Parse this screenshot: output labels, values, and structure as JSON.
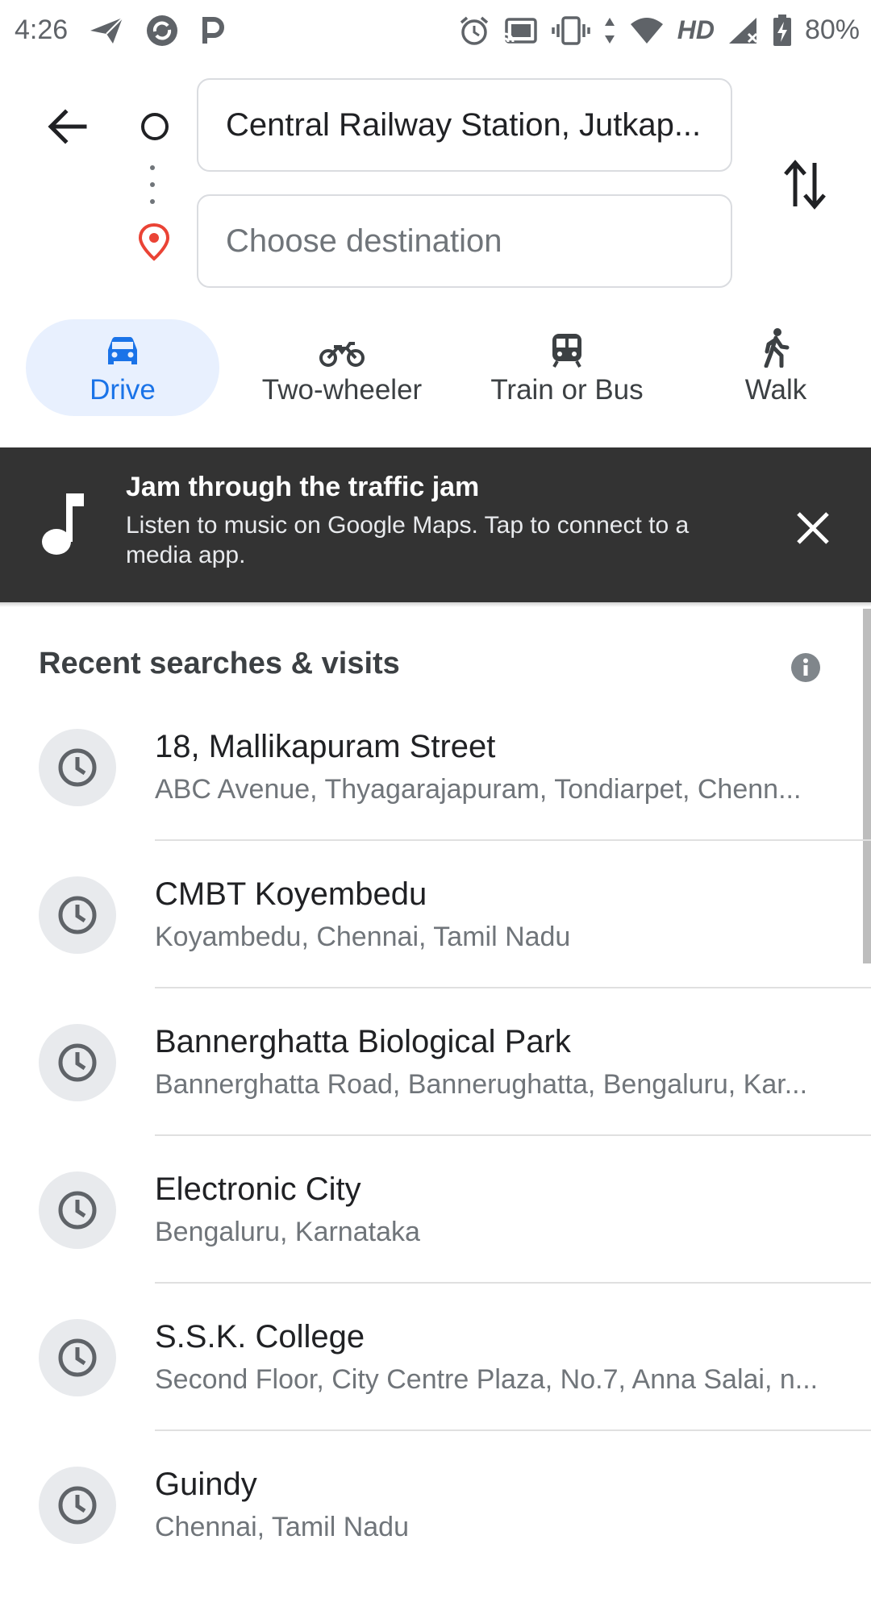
{
  "status_bar": {
    "time": "4:26",
    "network_label": "HD",
    "battery": "80%",
    "left_icons": [
      "send-icon",
      "sync-app-icon",
      "parking-icon"
    ],
    "right_icons": [
      "alarm-icon",
      "cast-icon",
      "vibrate-icon",
      "data-arrows-icon",
      "wifi-icon",
      "signal-icon",
      "battery-charging-icon"
    ]
  },
  "directions": {
    "origin": "Central Railway Station, Jutkap...",
    "destination_placeholder": "Choose destination"
  },
  "modes": [
    {
      "label": "Drive",
      "icon": "car-icon",
      "active": true
    },
    {
      "label": "Two-wheeler",
      "icon": "motorbike-icon",
      "active": false
    },
    {
      "label": "Train or Bus",
      "icon": "train-icon",
      "active": false
    },
    {
      "label": "Walk",
      "icon": "walk-icon",
      "active": false
    }
  ],
  "banner": {
    "title": "Jam through the traffic jam",
    "body": "Listen to music on Google Maps. Tap to connect to a media app."
  },
  "recent": {
    "title": "Recent searches & visits",
    "items": [
      {
        "title": "18, Mallikapuram Street",
        "subtitle": "ABC Avenue, Thyagarajapuram, Tondiarpet, Chenn..."
      },
      {
        "title": "CMBT Koyembedu",
        "subtitle": "Koyambedu, Chennai, Tamil Nadu"
      },
      {
        "title": "Bannerghatta Biological Park",
        "subtitle": "Bannerghatta Road, Bannerughatta, Bengaluru, Kar..."
      },
      {
        "title": "Electronic City",
        "subtitle": "Bengaluru, Karnataka"
      },
      {
        "title": "S.S.K. College",
        "subtitle": "Second Floor, City Centre Plaza, No.7, Anna Salai, n..."
      },
      {
        "title": "Guindy",
        "subtitle": "Chennai, Tamil Nadu"
      }
    ]
  },
  "colors": {
    "accent": "#1a73e8",
    "active_mode_bg": "#e8f0fe",
    "banner_bg": "#333333",
    "pin_red": "#ea4335"
  }
}
